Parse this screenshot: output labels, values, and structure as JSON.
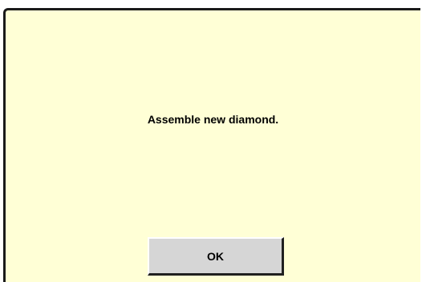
{
  "dialog": {
    "message": "Assemble new diamond.",
    "ok_label": "OK"
  },
  "colors": {
    "dialog_background": "#ffffd6",
    "button_background": "#d6d6d6",
    "text": "#000000"
  }
}
